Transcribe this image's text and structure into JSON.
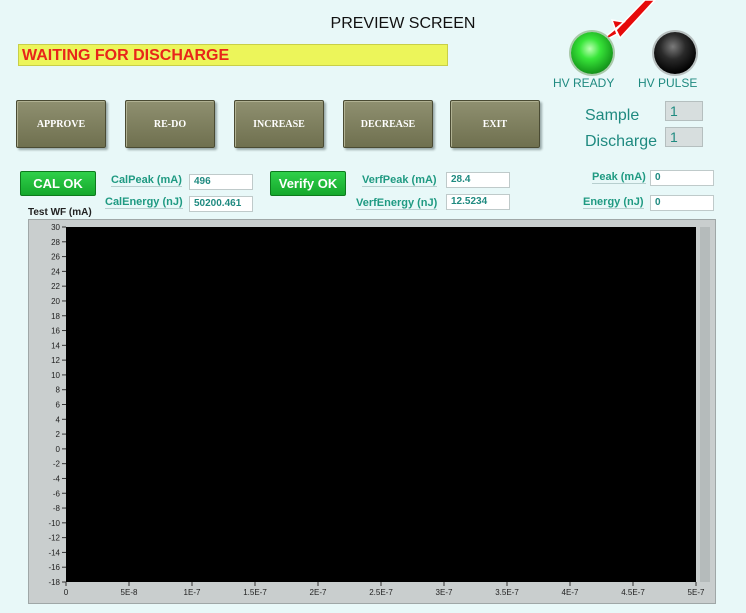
{
  "window": {
    "title": "PREVIEW SCREEN"
  },
  "status": {
    "message": "WAITING FOR DISCHARGE"
  },
  "indicators": {
    "hv_ready": {
      "label": "HV READY",
      "state": "on",
      "color": "#2fd43a"
    },
    "hv_pulse": {
      "label": "HV PULSE",
      "state": "off",
      "color": "#000000"
    }
  },
  "buttons": {
    "approve": "APPROVE",
    "redo": "RE-DO",
    "increase": "INCREASE",
    "decrease": "DECREASE",
    "exit": "EXIT"
  },
  "counters": {
    "sample_label": "Sample",
    "sample_value": "1",
    "discharge_label": "Discharge",
    "discharge_value": "1"
  },
  "calibration": {
    "ok_label": "CAL OK",
    "peak_label": "CalPeak (mA)",
    "peak_value": "496",
    "energy_label": "CalEnergy (nJ)",
    "energy_value": "50200.461"
  },
  "verification": {
    "ok_label": "Verify OK",
    "peak_label": "VerfPeak (mA)",
    "peak_value": "28.4",
    "energy_label": "VerfEnergy (nJ)",
    "energy_value": "12.5234"
  },
  "measurement": {
    "peak_label": "Peak (mA)",
    "peak_value": "0",
    "energy_label": "Energy (nJ)",
    "energy_value": "0"
  },
  "colors": {
    "accent_green": "#15a82c",
    "status_red": "#e8251a",
    "status_bg": "#ecf55a",
    "plot_bg": "#000000"
  },
  "chart_data": {
    "type": "line",
    "title": "Test WF (mA)",
    "xlabel": "",
    "ylabel": "",
    "xlim": [
      0,
      5e-07
    ],
    "ylim": [
      -18,
      30
    ],
    "x_ticks": [
      "0",
      "5E-8",
      "1E-7",
      "1.5E-7",
      "2E-7",
      "2.5E-7",
      "3E-7",
      "3.5E-7",
      "4E-7",
      "4.5E-7",
      "5E-7"
    ],
    "y_ticks": [
      "30",
      "28",
      "26",
      "24",
      "22",
      "20",
      "18",
      "16",
      "14",
      "12",
      "10",
      "8",
      "6",
      "4",
      "2",
      "0",
      "-2",
      "-4",
      "-6",
      "-8",
      "-10",
      "-12",
      "-14",
      "-16",
      "-18"
    ],
    "series": [],
    "grid": false
  }
}
